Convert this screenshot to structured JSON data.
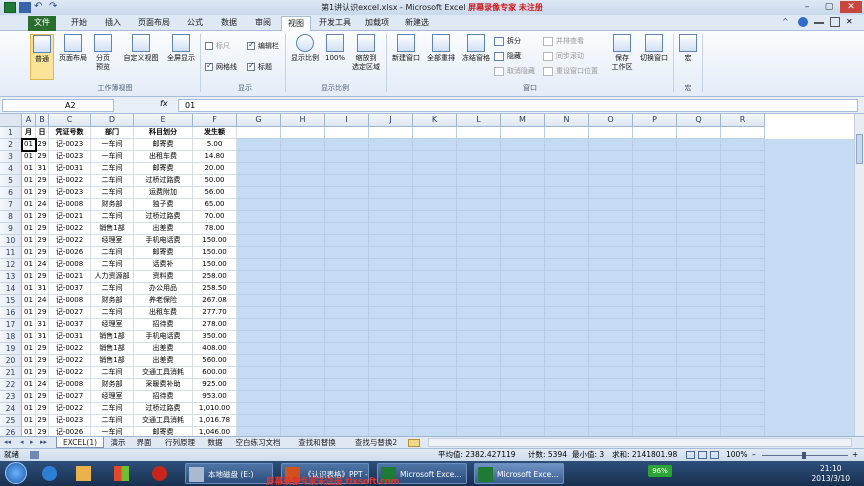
{
  "window": {
    "title_prefix": "第1讲认识excel.xlsx - Microsoft Excel",
    "watermark": "屏幕录像专家 未注册",
    "min": "–",
    "max": "▢",
    "close": "✕"
  },
  "tabs": {
    "file": "文件",
    "home": "开始",
    "insert": "插入",
    "layout": "页面布局",
    "formulas": "公式",
    "data": "数据",
    "review": "审阅",
    "view": "视图",
    "developer": "开发工具",
    "addins": "加载项",
    "newtab": "新建选"
  },
  "ribbon": {
    "workbook_views": {
      "label": "工作簿视图",
      "normal": "普通",
      "page_layout": "页面布局",
      "page_break_1": "分页",
      "page_break_2": "预览",
      "custom": "自定义视图",
      "fullscreen": "全屏显示"
    },
    "show": {
      "label": "显示",
      "ruler": "标尺",
      "gridlines": "网格线",
      "formula_bar": "编辑栏",
      "headings": "标题"
    },
    "zoom": {
      "label": "显示比例",
      "zoom": "显示比例",
      "hundred": "100%",
      "to_sel_1": "缩放到",
      "to_sel_2": "选定区域"
    },
    "window": {
      "label": "窗口",
      "new_window": "新建窗口",
      "arrange_all": "全部重排",
      "freeze": "冻结窗格",
      "split": "拆分",
      "hide": "隐藏",
      "unhide": "取消隐藏",
      "side_by_side": "并排查看",
      "sync_scroll": "同步滚动",
      "reset_pos": "重设窗口位置",
      "save_ws_1": "保存",
      "save_ws_2": "工作区",
      "switch": "切换窗口"
    },
    "macros": {
      "label": "宏",
      "macros": "宏"
    }
  },
  "formula": {
    "name_box": "A2",
    "fx": "fx",
    "value": "01"
  },
  "columns": [
    "A",
    "B",
    "C",
    "D",
    "E",
    "F",
    "G",
    "H",
    "I",
    "J",
    "K",
    "L",
    "M",
    "N",
    "O",
    "P",
    "Q",
    "R"
  ],
  "headers": [
    "月",
    "日",
    "凭证号数",
    "部门",
    "科目划分",
    "发生额"
  ],
  "rows": [
    [
      "01",
      "29",
      "记-0023",
      "一车间",
      "邮寄费",
      "5.00"
    ],
    [
      "01",
      "29",
      "记-0023",
      "一车间",
      "出租车费",
      "14.80"
    ],
    [
      "01",
      "31",
      "记-0031",
      "二车间",
      "邮寄费",
      "20.00"
    ],
    [
      "01",
      "29",
      "记-0022",
      "二车间",
      "过桥过路费",
      "50.00"
    ],
    [
      "01",
      "29",
      "记-0023",
      "二车间",
      "运费附加",
      "56.00"
    ],
    [
      "01",
      "24",
      "记-0008",
      "财务部",
      "独子费",
      "65.00"
    ],
    [
      "01",
      "29",
      "记-0021",
      "二车间",
      "过桥过路费",
      "70.00"
    ],
    [
      "01",
      "29",
      "记-0022",
      "销售1部",
      "出差费",
      "78.00"
    ],
    [
      "01",
      "29",
      "记-0022",
      "经理室",
      "手机电话费",
      "150.00"
    ],
    [
      "01",
      "29",
      "记-0026",
      "二车间",
      "邮寄费",
      "150.00"
    ],
    [
      "01",
      "24",
      "记-0008",
      "二车间",
      "话费补",
      "150.00"
    ],
    [
      "01",
      "29",
      "记-0021",
      "人力资源部",
      "资料费",
      "258.00"
    ],
    [
      "01",
      "31",
      "记-0037",
      "二车间",
      "办公用品",
      "258.50"
    ],
    [
      "01",
      "24",
      "记-0008",
      "财务部",
      "养老保险",
      "267.08"
    ],
    [
      "01",
      "29",
      "记-0027",
      "二车间",
      "出租车费",
      "277.70"
    ],
    [
      "01",
      "31",
      "记-0037",
      "经理室",
      "招待费",
      "278.00"
    ],
    [
      "01",
      "31",
      "记-0031",
      "销售1部",
      "手机电话费",
      "350.00"
    ],
    [
      "01",
      "29",
      "记-0022",
      "销售1部",
      "出差费",
      "408.00"
    ],
    [
      "01",
      "29",
      "记-0022",
      "销售1部",
      "出差费",
      "560.00"
    ],
    [
      "01",
      "29",
      "记-0022",
      "二车间",
      "交通工具消耗",
      "600.00"
    ],
    [
      "01",
      "24",
      "记-0008",
      "财务部",
      "采暖费补助",
      "925.00"
    ],
    [
      "01",
      "29",
      "记-0027",
      "经理室",
      "招待费",
      "953.00"
    ],
    [
      "01",
      "29",
      "记-0022",
      "二车间",
      "过桥过路费",
      "1,010.00"
    ],
    [
      "01",
      "29",
      "记-0023",
      "二车间",
      "交通工具消耗",
      "1,016.78"
    ],
    [
      "01",
      "29",
      "记-0026",
      "一车间",
      "邮寄费",
      "1,046.00"
    ]
  ],
  "sheets": [
    "EXCEL(1)",
    "演示",
    "界面",
    "行列原理",
    "数据",
    "空白练习文档",
    "查找和替换",
    "查找与替换2"
  ],
  "status": {
    "ready": "就绪",
    "average": "平均值: 2382.427119",
    "count": "计数: 5394",
    "min": "最小值: 3",
    "sum": "求和: 2141801.98",
    "zoom": "100%",
    "minus": "–",
    "plus": "+"
  },
  "taskbar": {
    "disk": "本地磁盘 (E:)",
    "ppt": "《认识表格》PPT - 小...",
    "excel1": "Microsoft Exce...",
    "excel2": "Microsoft Exce...",
    "battery": "96%",
    "time": "21:10",
    "date": "2013/3/10",
    "watermark": "屏幕录像专家未注册 tlxsoft.com"
  },
  "colors": {
    "file_tab": "#2a6e2f",
    "selection": "#c4dcf3",
    "watermark": "#e4322b"
  }
}
